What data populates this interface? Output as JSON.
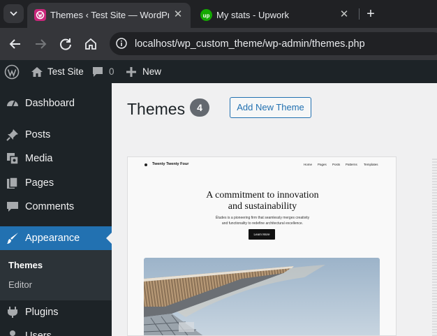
{
  "browser": {
    "tabs": [
      {
        "title": "Themes ‹ Test Site — WordPress",
        "active": true,
        "favicon": "wordpress-pink-icon"
      },
      {
        "title": "My stats - Upwork",
        "active": false,
        "favicon": "upwork-icon"
      }
    ],
    "close_glyph": "✕",
    "new_tab_glyph": "+",
    "url": "localhost/wp_custom_theme/wp-admin/themes.php"
  },
  "adminbar": {
    "site_name": "Test Site",
    "comments_count": "0",
    "new_label": "New"
  },
  "sidebar": {
    "items": [
      {
        "label": "Dashboard",
        "icon": "dashboard-icon"
      },
      {
        "label": "Posts",
        "icon": "pin-icon"
      },
      {
        "label": "Media",
        "icon": "media-icon"
      },
      {
        "label": "Pages",
        "icon": "pages-icon"
      },
      {
        "label": "Comments",
        "icon": "comment-icon"
      },
      {
        "label": "Appearance",
        "icon": "brush-icon",
        "current": true
      },
      {
        "label": "Plugins",
        "icon": "plugin-icon"
      },
      {
        "label": "Users",
        "icon": "users-icon"
      }
    ],
    "submenu": [
      {
        "label": "Themes",
        "current": true
      },
      {
        "label": "Editor"
      }
    ]
  },
  "main": {
    "title": "Themes",
    "count": "4",
    "add_new_label": "Add New Theme"
  },
  "theme_preview": {
    "site_title": "Twenty Twenty Four",
    "nav": [
      "Home",
      "Pages",
      "Posts",
      "Patterns",
      "Templates"
    ],
    "heading_line1": "A commitment to innovation",
    "heading_line2": "and sustainability",
    "para_line1": "Études is a pioneering firm that seamlessly merges creativity",
    "para_line2": "and functionality to redefine architectural excellence.",
    "button": "Learn More"
  },
  "colors": {
    "admin_dark": "#1d2327",
    "accent": "#2271b1",
    "browser_dark": "#202124"
  }
}
